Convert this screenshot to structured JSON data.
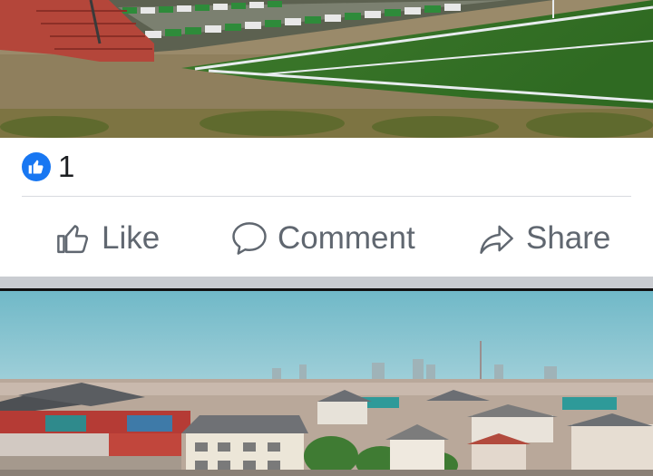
{
  "post": {
    "reactions": {
      "icon": "thumbs-up-icon",
      "count": "1",
      "color": "#1877f2"
    },
    "actions": [
      {
        "icon": "thumbs-up-outline-icon",
        "label": "Like"
      },
      {
        "icon": "speech-bubble-icon",
        "label": "Comment"
      },
      {
        "icon": "share-arrow-icon",
        "label": "Share"
      }
    ]
  },
  "colors": {
    "text_muted": "#606770",
    "divider": "#d8dadf",
    "feed_gap": "#c9ccd1"
  }
}
